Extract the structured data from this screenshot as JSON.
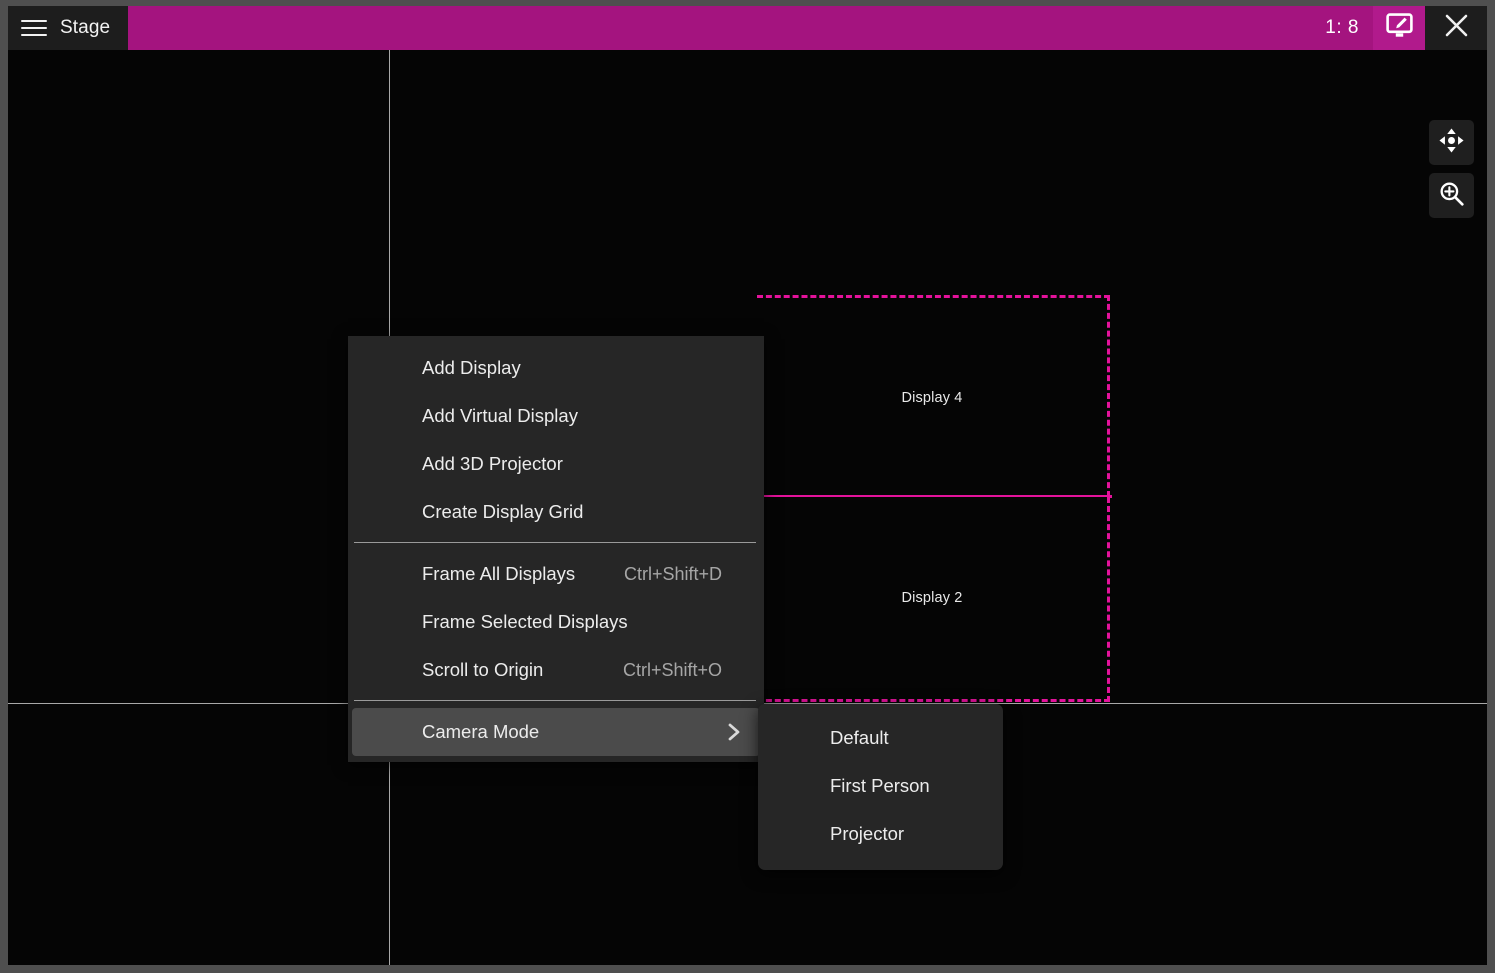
{
  "window": {
    "title": "Stage",
    "scale_label": "1: 8",
    "menu_icon": "hamburger-icon",
    "edit_display_icon": "monitor-edit-icon",
    "close_icon": "close-icon",
    "accent_color": "#a4147f",
    "edit_button_color": "#b11a8c"
  },
  "toolbar": {
    "buttons": [
      {
        "name": "pan-tool",
        "icon": "move-pan-icon"
      },
      {
        "name": "zoom-tool",
        "icon": "zoom-in-icon"
      }
    ]
  },
  "stage": {
    "background_color": "#050505",
    "axis_color": "#a8a8a8",
    "selection_color": "#e4129b",
    "displays": [
      {
        "label": "Display 4"
      },
      {
        "label": "Display 2"
      }
    ]
  },
  "context_menu": {
    "groups": [
      {
        "items": [
          {
            "label": "Add Display",
            "shortcut": "",
            "highlight": false,
            "submenu": false
          },
          {
            "label": "Add Virtual Display",
            "shortcut": "",
            "highlight": false,
            "submenu": false
          },
          {
            "label": "Add 3D Projector",
            "shortcut": "",
            "highlight": false,
            "submenu": false
          },
          {
            "label": "Create Display Grid",
            "shortcut": "",
            "highlight": false,
            "submenu": false
          }
        ]
      },
      {
        "items": [
          {
            "label": "Frame All Displays",
            "shortcut": "Ctrl+Shift+D",
            "highlight": false,
            "submenu": false
          },
          {
            "label": "Frame Selected Displays",
            "shortcut": "",
            "highlight": false,
            "submenu": false
          },
          {
            "label": "Scroll to Origin",
            "shortcut": "Ctrl+Shift+O",
            "highlight": false,
            "submenu": false
          }
        ]
      },
      {
        "items": [
          {
            "label": "Camera Mode",
            "shortcut": "",
            "highlight": true,
            "submenu": true
          }
        ]
      }
    ]
  },
  "camera_submenu": {
    "items": [
      {
        "label": "Default"
      },
      {
        "label": "First Person"
      },
      {
        "label": "Projector"
      }
    ]
  }
}
